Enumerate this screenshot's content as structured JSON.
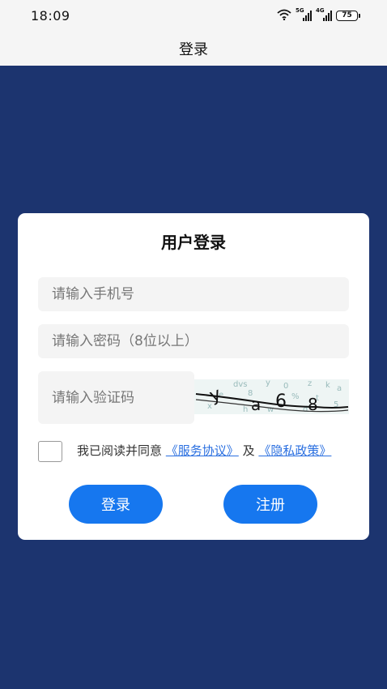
{
  "status_bar": {
    "time": "18:09",
    "net1": "5G",
    "net2": "4G",
    "battery": "75",
    "icons": [
      "wifi-icon",
      "signal-5g-icon",
      "signal-4g-icon",
      "battery-icon"
    ]
  },
  "nav": {
    "title": "登录"
  },
  "form": {
    "title": "用户登录",
    "phone_placeholder": "请输入手机号",
    "password_placeholder": "请输入密码（8位以上）",
    "code_placeholder": "请输入验证码",
    "captcha_text": "y a 6 8",
    "agree_prefix": "我已阅读并同意",
    "service_link": "《服务协议》",
    "agree_and": "及",
    "privacy_link": "《隐私政策》",
    "login_button": "登录",
    "register_button": "注册"
  },
  "colors": {
    "background": "#1c346f",
    "card": "#ffffff",
    "button": "#1677ef",
    "link": "#2a6fe0"
  }
}
